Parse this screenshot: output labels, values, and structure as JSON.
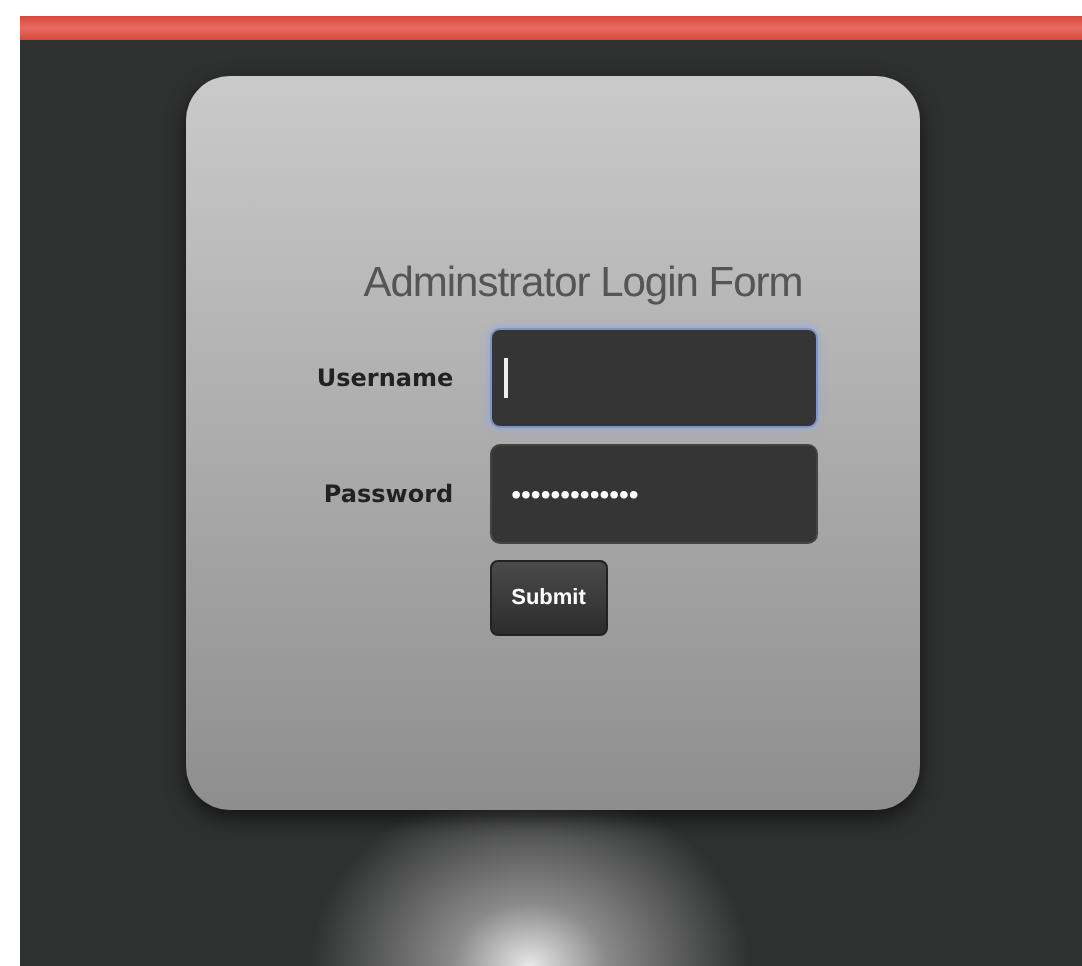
{
  "form": {
    "title": "Adminstrator Login Form",
    "fields": [
      {
        "label": "Username",
        "focused": true
      },
      {
        "label": "Password",
        "value": "•••••••••••••",
        "focused": false
      }
    ],
    "submit": "Submit"
  }
}
